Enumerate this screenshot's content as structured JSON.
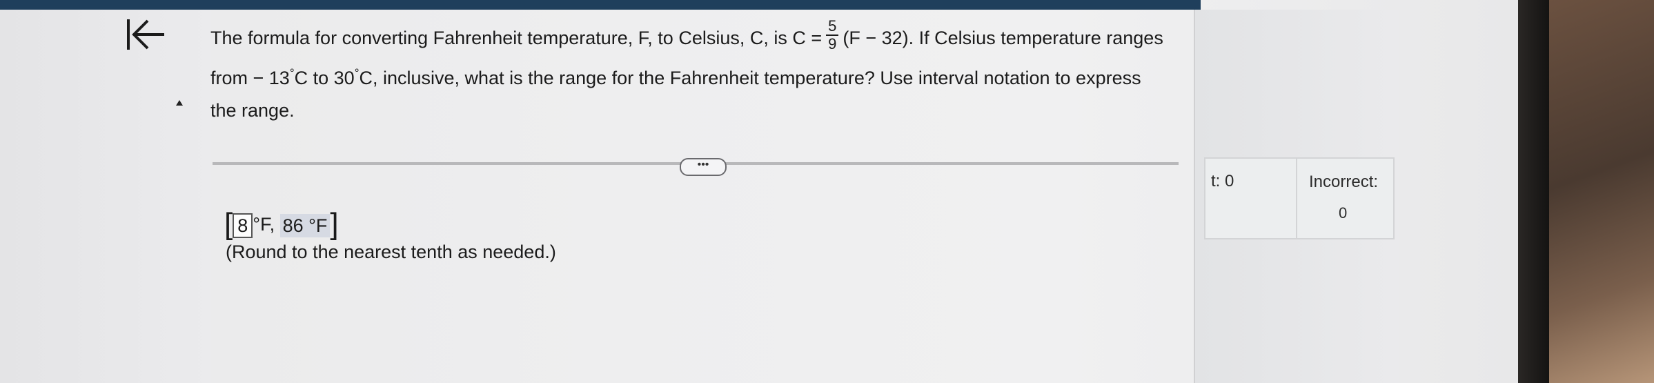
{
  "question": {
    "line1_before": "The formula for converting Fahrenheit temperature, F, to Celsius, C, is C =",
    "fraction_numerator": "5",
    "fraction_denominator": "9",
    "line1_after": "(F − 32).  If Celsius temperature ranges",
    "line2_a": "from  − 13",
    "line2_b": "C to 30",
    "line2_c": "C, inclusive, what is the range for the Fahrenheit temperature?  Use interval notation to express",
    "line3": "the range.",
    "degree_symbol": "°"
  },
  "more_button": {
    "label": "•••"
  },
  "answer": {
    "open_bracket": "[",
    "lower_value": "8",
    "lower_unit": "°F,",
    "upper_value": "86 °F",
    "close_bracket": "]",
    "note": "(Round to the nearest tenth as needed.)"
  },
  "stats": {
    "left_label": "t: 0",
    "right_label": "Incorrect:",
    "right_value": "0"
  },
  "colors": {
    "top_bar": "#1f3f5c",
    "input_highlight": "#d6dae3"
  },
  "icons": {
    "back": "first-page-icon",
    "collapse": "caret-up-icon"
  }
}
